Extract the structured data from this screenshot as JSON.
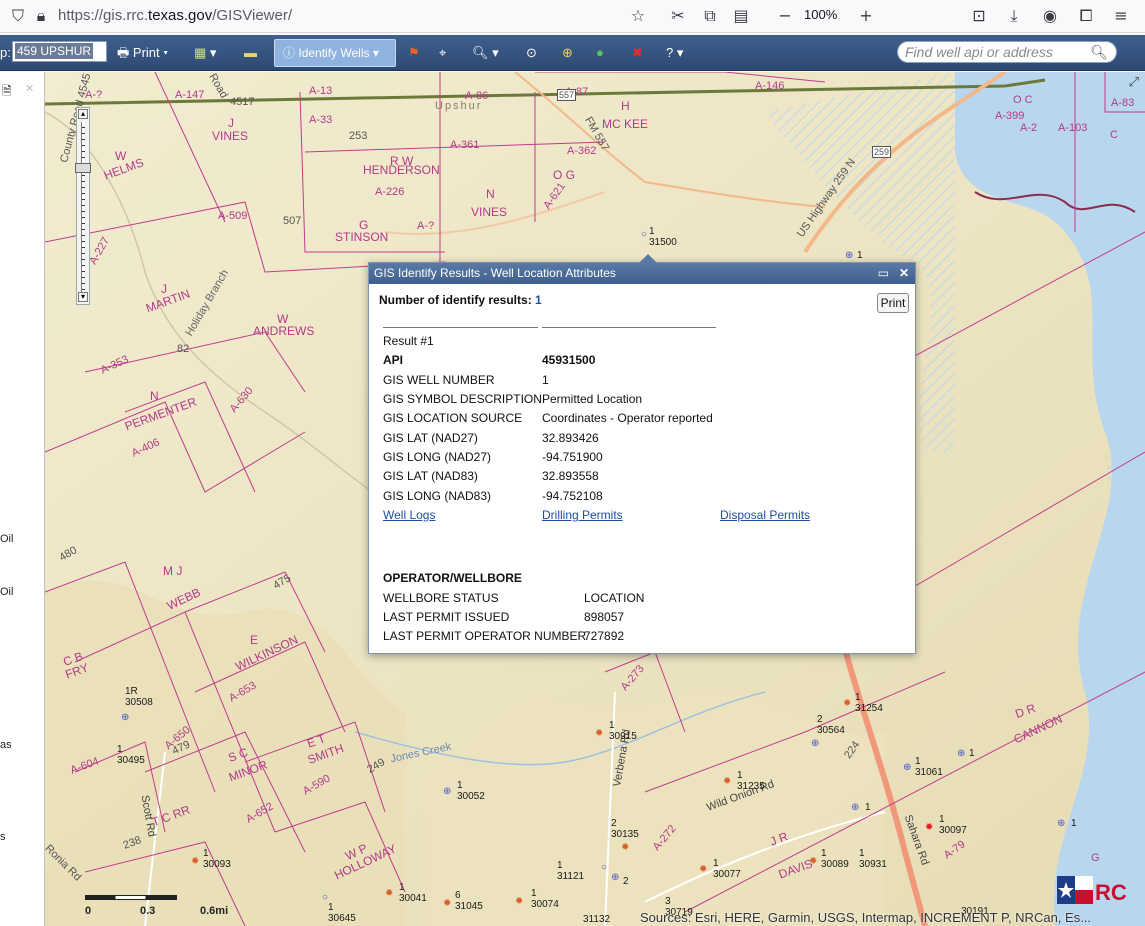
{
  "browser": {
    "url_prefix": "https://gis.rrc.",
    "url_domain": "texas.gov",
    "url_path": "/GISViewer/",
    "zoom": "100%"
  },
  "toolbar": {
    "county_prefix": "p:",
    "county_value": "459 UPSHUR",
    "print_label": "Print",
    "identify_label": "Identify Wells",
    "search_placeholder": "Find well api or address"
  },
  "left_panel": {
    "items": [
      "Oil",
      "Oil",
      "as",
      "s"
    ]
  },
  "map": {
    "survey_labels": [
      {
        "text": "A-147"
      },
      {
        "text": "A-?"
      },
      {
        "text": "A-13"
      },
      {
        "text": "A-86"
      },
      {
        "text": "A-87"
      },
      {
        "text": "A-146"
      },
      {
        "text": "A-33"
      },
      {
        "text": "J"
      },
      {
        "text": "VINES"
      },
      {
        "text": "MC KEE"
      },
      {
        "text": "H"
      },
      {
        "text": "W"
      },
      {
        "text": "HELMS"
      },
      {
        "text": "A-361"
      },
      {
        "text": "A-362"
      },
      {
        "text": "R W"
      },
      {
        "text": "HENDERSON"
      },
      {
        "text": "A-226"
      },
      {
        "text": "O G"
      },
      {
        "text": "A-621"
      },
      {
        "text": "N"
      },
      {
        "text": "VINES"
      },
      {
        "text": "A-509"
      },
      {
        "text": "G"
      },
      {
        "text": "STINSON"
      },
      {
        "text": "A-?"
      },
      {
        "text": "A-227"
      },
      {
        "text": "J"
      },
      {
        "text": "MARTIN"
      },
      {
        "text": "W"
      },
      {
        "text": "ANDREWS"
      },
      {
        "text": "A-353"
      },
      {
        "text": "N"
      },
      {
        "text": "PERMENTER"
      },
      {
        "text": "A-406"
      },
      {
        "text": "A-630"
      },
      {
        "text": "M J"
      },
      {
        "text": "WEBB"
      },
      {
        "text": "E"
      },
      {
        "text": "WILKINSON"
      },
      {
        "text": "C B"
      },
      {
        "text": "FRY"
      },
      {
        "text": "A-653"
      },
      {
        "text": "S C"
      },
      {
        "text": "MINOR"
      },
      {
        "text": "E T"
      },
      {
        "text": "SMITH"
      },
      {
        "text": "A-652"
      },
      {
        "text": "A-590"
      },
      {
        "text": "A-604"
      },
      {
        "text": "A-650"
      },
      {
        "text": "T C RR"
      },
      {
        "text": "W P"
      },
      {
        "text": "HOLLOWAY"
      },
      {
        "text": "A-273"
      },
      {
        "text": "A-272"
      },
      {
        "text": "J R"
      },
      {
        "text": "DAVIS"
      },
      {
        "text": "A-79"
      },
      {
        "text": "D R"
      },
      {
        "text": "CANNON"
      },
      {
        "text": "A-399"
      },
      {
        "text": "O C"
      },
      {
        "text": "A-2"
      },
      {
        "text": "A-103"
      },
      {
        "text": "C"
      },
      {
        "text": "A-83"
      },
      {
        "text": "G"
      }
    ],
    "road_labels": [
      {
        "text": "Upshur"
      },
      {
        "text": "FM 557"
      },
      {
        "text": "US Highway 259 N"
      },
      {
        "text": "Wild Onion Rd"
      },
      {
        "text": "Verbena Rd"
      },
      {
        "text": "Scott Rd"
      },
      {
        "text": "Sahara Rd"
      },
      {
        "text": "Holiday Branch"
      },
      {
        "text": "Jones Creek"
      },
      {
        "text": "4517"
      },
      {
        "text": "County Road 4545"
      },
      {
        "text": "Road"
      },
      {
        "text": "253"
      },
      {
        "text": "507"
      },
      {
        "text": "475"
      },
      {
        "text": "480"
      },
      {
        "text": "249"
      },
      {
        "text": "238"
      },
      {
        "text": "479"
      },
      {
        "text": "224"
      },
      {
        "text": "82"
      },
      {
        "text": "Ronia Rd"
      },
      {
        "text": "557"
      },
      {
        "text": "259"
      }
    ],
    "wells": [
      {
        "label": "1\n31500"
      },
      {
        "label": "1"
      },
      {
        "label": "1\n31254"
      },
      {
        "label": "2\n30564"
      },
      {
        "label": "1\n31061"
      },
      {
        "label": "1"
      },
      {
        "label": "1\n30915"
      },
      {
        "label": "1\n31235"
      },
      {
        "label": "1"
      },
      {
        "label": "1\n30097"
      },
      {
        "label": "1"
      },
      {
        "label": "1\n30052"
      },
      {
        "label": "2\n30135"
      },
      {
        "label": "1\n30077"
      },
      {
        "label": "1\n30089"
      },
      {
        "label": "1\n30931"
      },
      {
        "label": "1\n31121"
      },
      {
        "label": "2"
      },
      {
        "label": "1R\n30508"
      },
      {
        "label": "1\n30495"
      },
      {
        "label": "1\n30093"
      },
      {
        "label": "1\n30041"
      },
      {
        "label": "6\n31045"
      },
      {
        "label": "1\n30074"
      },
      {
        "label": "1\n30645"
      },
      {
        "label": "31132"
      },
      {
        "label": "3\n30719"
      },
      {
        "label": "30191"
      }
    ],
    "scale": {
      "t0": "0",
      "t1": "0.3",
      "t2": "0.6mi"
    },
    "attribution": "Sources: Esri, HERE, Garmin, USGS, Intermap, INCREMENT P, NRCan, Es..."
  },
  "popup": {
    "title": "GIS Identify Results - Well Location Attributes",
    "count_label": "Number of identify results:",
    "count_value": "1",
    "print_label": "Print",
    "result_label": "Result #1",
    "rows": [
      {
        "label": "API",
        "value": "45931500"
      },
      {
        "label": "GIS WELL NUMBER",
        "value": "1"
      },
      {
        "label": "GIS SYMBOL DESCRIPTION",
        "value": "Permitted Location"
      },
      {
        "label": "GIS LOCATION SOURCE",
        "value": "Coordinates - Operator reported"
      },
      {
        "label": "GIS LAT (NAD27)",
        "value": "32.893426"
      },
      {
        "label": "GIS LONG (NAD27)",
        "value": "-94.751900"
      },
      {
        "label": "GIS LAT (NAD83)",
        "value": "32.893558"
      },
      {
        "label": "GIS LONG (NAD83)",
        "value": "-94.752108"
      }
    ],
    "links": {
      "well_logs": "Well Logs",
      "drilling_permits": "Drilling Permits",
      "disposal_permits": "Disposal Permits"
    },
    "section_title": "OPERATOR/WELLBORE",
    "operator_rows": [
      {
        "label": "WELLBORE STATUS",
        "value": "LOCATION"
      },
      {
        "label": "LAST PERMIT ISSUED",
        "value": "898057"
      },
      {
        "label": "LAST PERMIT OPERATOR NUMBER",
        "value": "727892"
      }
    ]
  },
  "colors": {
    "toolbar": "#3f5f8c",
    "survey_line": "#c23b8e",
    "map_bg": "#efe8c6",
    "water": "#b9d6ef",
    "link": "#1f4fa3"
  }
}
